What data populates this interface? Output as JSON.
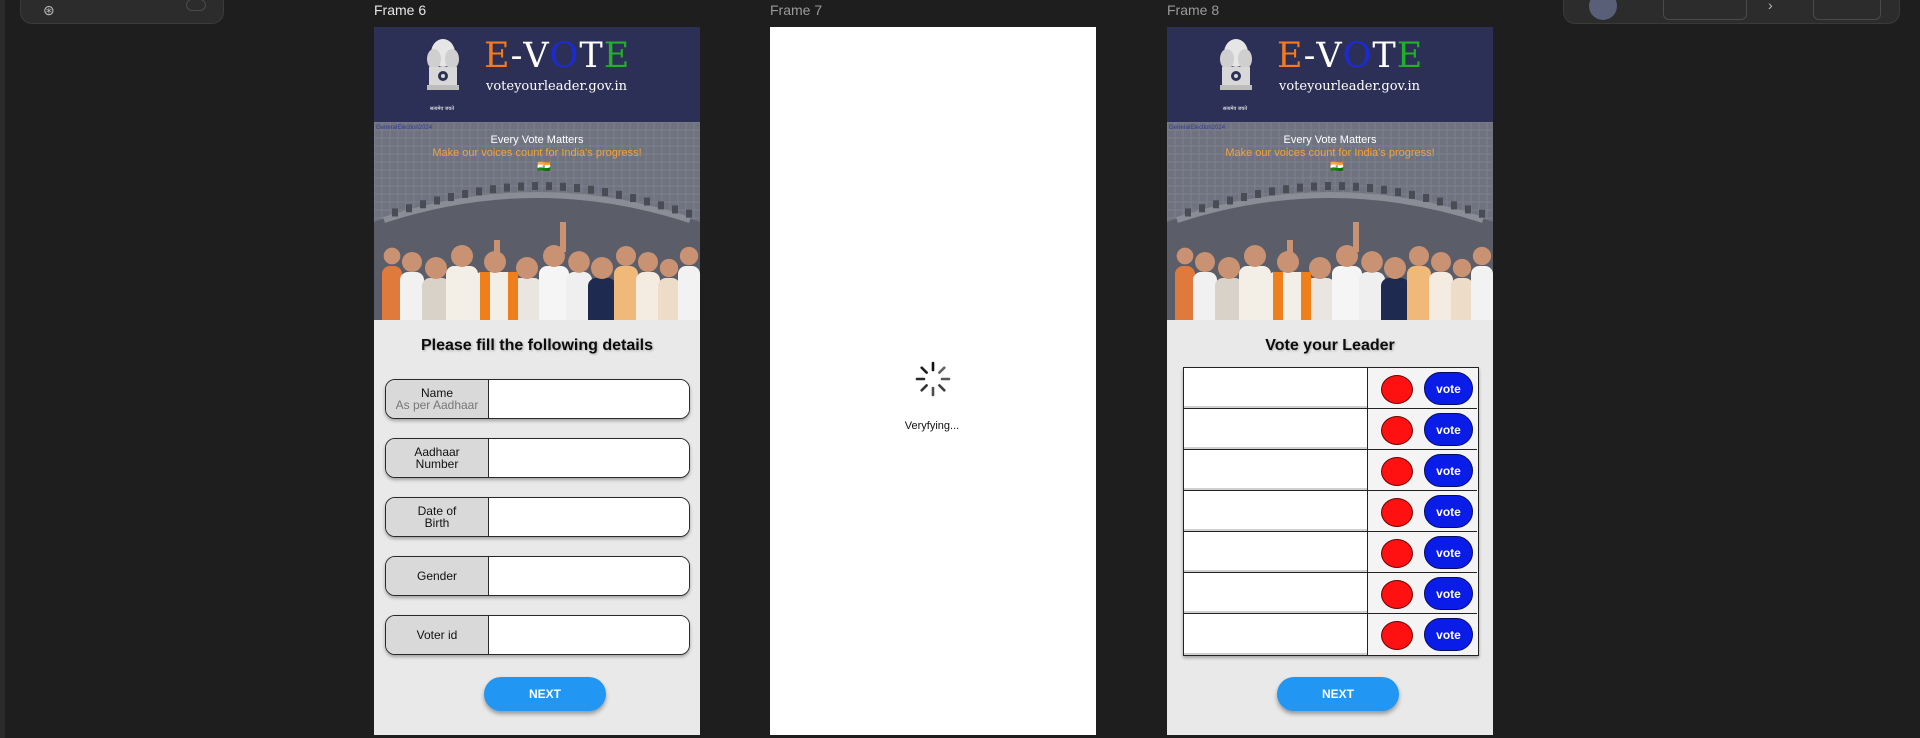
{
  "canvas": {
    "frames": [
      {
        "label": "Frame 6"
      },
      {
        "label": "Frame 7"
      },
      {
        "label": "Frame 8"
      }
    ]
  },
  "app": {
    "logo_letters": [
      {
        "char": "E",
        "color": "#f37a1f"
      },
      {
        "char": "-",
        "color": "#ffffff"
      },
      {
        "char": "V",
        "color": "#ffffff"
      },
      {
        "char": "O",
        "color": "#1b2ad6"
      },
      {
        "char": "T",
        "color": "#ffffff"
      },
      {
        "char": "E",
        "color": "#22b02a"
      }
    ],
    "site_url": "voteyourleader.gov.in",
    "emblem_caption": "सत्यमेव जयते",
    "banner": {
      "hashtag": "GeneralElection2024",
      "tagline_main": "Every Vote Matters",
      "tagline_sub": "Make our voices count for India's progress!",
      "flag": "🇮🇳"
    }
  },
  "form_screen": {
    "title": "Please fill the following details",
    "fields": [
      {
        "label": "Name",
        "hint": "As per Aadhaar",
        "value": ""
      },
      {
        "label": "Aadhaar Number",
        "hint": "",
        "value": ""
      },
      {
        "label": "Date of Birth",
        "hint": "",
        "value": ""
      },
      {
        "label": "Gender",
        "hint": "",
        "value": ""
      },
      {
        "label": "Voter id",
        "hint": "",
        "value": ""
      }
    ],
    "next_label": "NEXT"
  },
  "loading_screen": {
    "status_text": "Veryfying..."
  },
  "ballot_screen": {
    "title": "Vote your Leader",
    "rows": [
      {
        "candidate": "",
        "vote_label": "vote"
      },
      {
        "candidate": "",
        "vote_label": "vote"
      },
      {
        "candidate": "",
        "vote_label": "vote"
      },
      {
        "candidate": "",
        "vote_label": "vote"
      },
      {
        "candidate": "",
        "vote_label": "vote"
      },
      {
        "candidate": "",
        "vote_label": "vote"
      },
      {
        "candidate": "",
        "vote_label": "vote"
      }
    ],
    "next_label": "NEXT"
  },
  "colors": {
    "header_bg": "#2d3056",
    "primary_button": "#2196f3",
    "vote_button": "#0a1de8",
    "ballot_dot": "#ff1111",
    "tagline_accent": "#f5a23a"
  }
}
